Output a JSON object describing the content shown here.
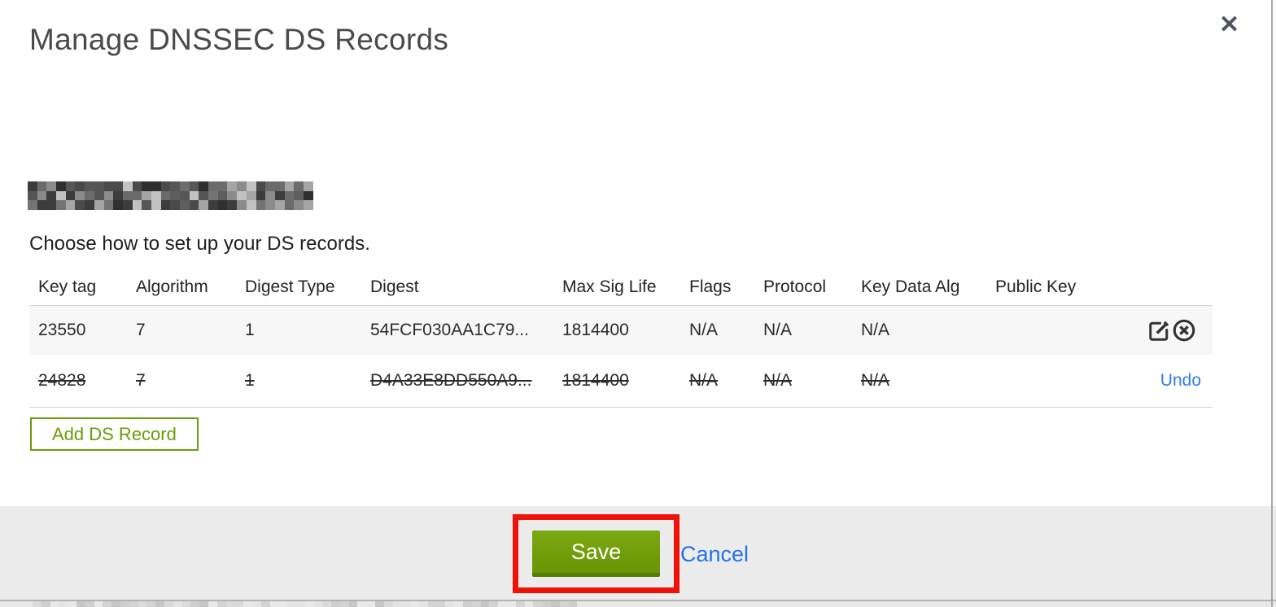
{
  "modal": {
    "title": "Manage DNSSEC DS Records",
    "close_glyph": "✕",
    "domain": {
      "redacted": true
    },
    "subtitle": "Choose how to set up your DS records.",
    "table": {
      "columns": [
        "Key tag",
        "Algorithm",
        "Digest Type",
        "Digest",
        "Max Sig Life",
        "Flags",
        "Protocol",
        "Key Data Alg",
        "Public Key"
      ],
      "rows": [
        {
          "key_tag": "23550",
          "algorithm": "7",
          "digest_type": "1",
          "digest": "54FCF030AA1C79...",
          "max_sig_life": "1814400",
          "flags": "N/A",
          "protocol": "N/A",
          "key_data_alg": "N/A",
          "public_key": "",
          "state": "normal",
          "actions": [
            "edit",
            "delete"
          ]
        },
        {
          "key_tag": "24828",
          "algorithm": "7",
          "digest_type": "1",
          "digest": "D4A33E8DD550A9...",
          "max_sig_life": "1814400",
          "flags": "N/A",
          "protocol": "N/A",
          "key_data_alg": "N/A",
          "public_key": "",
          "state": "deleted",
          "undo_label": "Undo"
        }
      ]
    },
    "add_button_label": "Add DS Record",
    "footer": {
      "save_label": "Save",
      "cancel_label": "Cancel"
    }
  },
  "icons": {
    "close": "x-close",
    "edit": "square-pencil-edit",
    "delete": "circle-x-delete"
  },
  "colors": {
    "accent_green": "#6b9c0a",
    "save_button_green": "#71a00c",
    "save_button_border": "#577e04",
    "annotation_red": "#ee1209",
    "link_blue": "#2a79ec",
    "footer_gray": "#ececec",
    "row_stripe_gray": "#f7f7f7"
  }
}
